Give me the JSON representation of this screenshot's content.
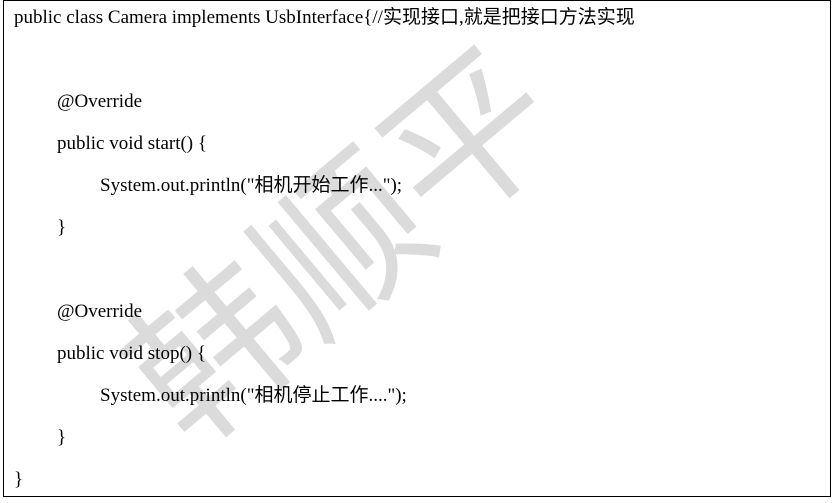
{
  "code": {
    "lines": [
      "public class Camera implements UsbInterface{//实现接口,就是把接口方法实现",
      "@Override",
      "public void start() {",
      "System.out.println(\"相机开始工作...\");",
      "}",
      "@Override",
      "public void stop() {",
      "System.out.println(\"相机停止工作....\");",
      "}",
      "}"
    ]
  },
  "watermark": {
    "text": "韩顺平",
    "color": "#d9d9d9"
  }
}
